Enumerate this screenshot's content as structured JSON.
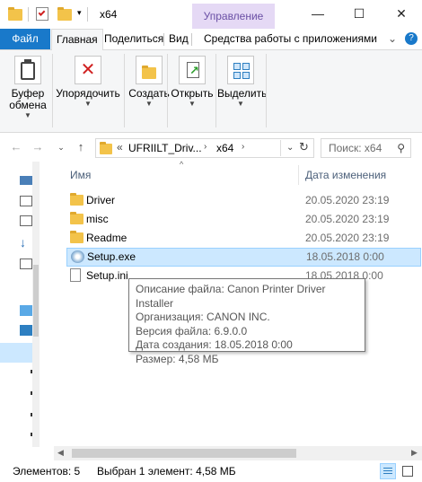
{
  "window": {
    "title": "x64",
    "manage_tab": "Управление",
    "minimize": "—",
    "maximize": "☐",
    "close": "✕"
  },
  "ribbon_tabs": {
    "file": "Файл",
    "home": "Главная",
    "share": "Поделиться",
    "view": "Вид",
    "tools": "Средства работы с приложениями",
    "collapse": "⌄",
    "help": "?"
  },
  "ribbon": {
    "clipboard": "Буфер\nобмена",
    "organize": "Упорядочить",
    "new": "Создать",
    "open": "Открыть",
    "select": "Выделить"
  },
  "address": {
    "overflow": "«",
    "crumb1": "UFRIILT_Driv...",
    "crumb2": "x64",
    "search_placeholder": "Поиск: x64"
  },
  "columns": {
    "name": "Имя",
    "date": "Дата изменения"
  },
  "files": [
    {
      "name": "Driver",
      "date": "20.05.2020 23:19",
      "icon": "folder-icon"
    },
    {
      "name": "misc",
      "date": "20.05.2020 23:19",
      "icon": "folder-icon"
    },
    {
      "name": "Readme",
      "date": "20.05.2020 23:19",
      "icon": "folder-icon"
    },
    {
      "name": "Setup.exe",
      "date": "18.05.2018 0:00",
      "icon": "setup-exe-icon"
    },
    {
      "name": "Setup.ini",
      "date": "18.05.2018 0:00",
      "icon": "ini-file-icon"
    }
  ],
  "tooltip": {
    "line1": "Описание файла: Canon Printer Driver Installer",
    "line2": "Организация: CANON INC.",
    "line3": "Версия файла: 6.9.0.0",
    "line4": "Дата создания: 18.05.2018 0:00",
    "line5": "Размер: 4,58 МБ"
  },
  "status": {
    "count": "Элементов: 5",
    "selection": "Выбран 1 элемент: 4,58 МБ"
  },
  "colors": {
    "accent": "#1979ca",
    "selection": "#cce8ff",
    "manage_tab_bg": "#e5d9f5",
    "folder": "#f3c34a"
  }
}
